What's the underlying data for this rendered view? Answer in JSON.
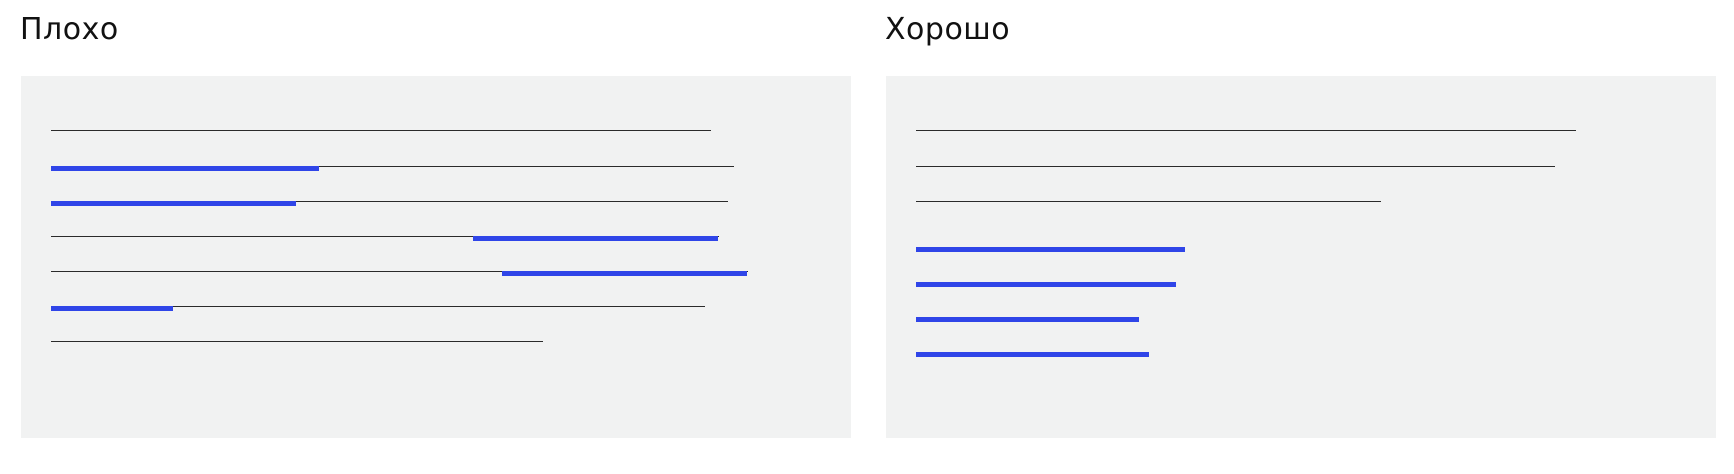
{
  "colors": {
    "background": "#ffffff",
    "panel": "#f1f2f2",
    "text_line": "#2b2b2b",
    "highlight": "#2f45e8"
  },
  "bad": {
    "title": "Плохо"
  },
  "good": {
    "title": "Хорошо"
  }
}
